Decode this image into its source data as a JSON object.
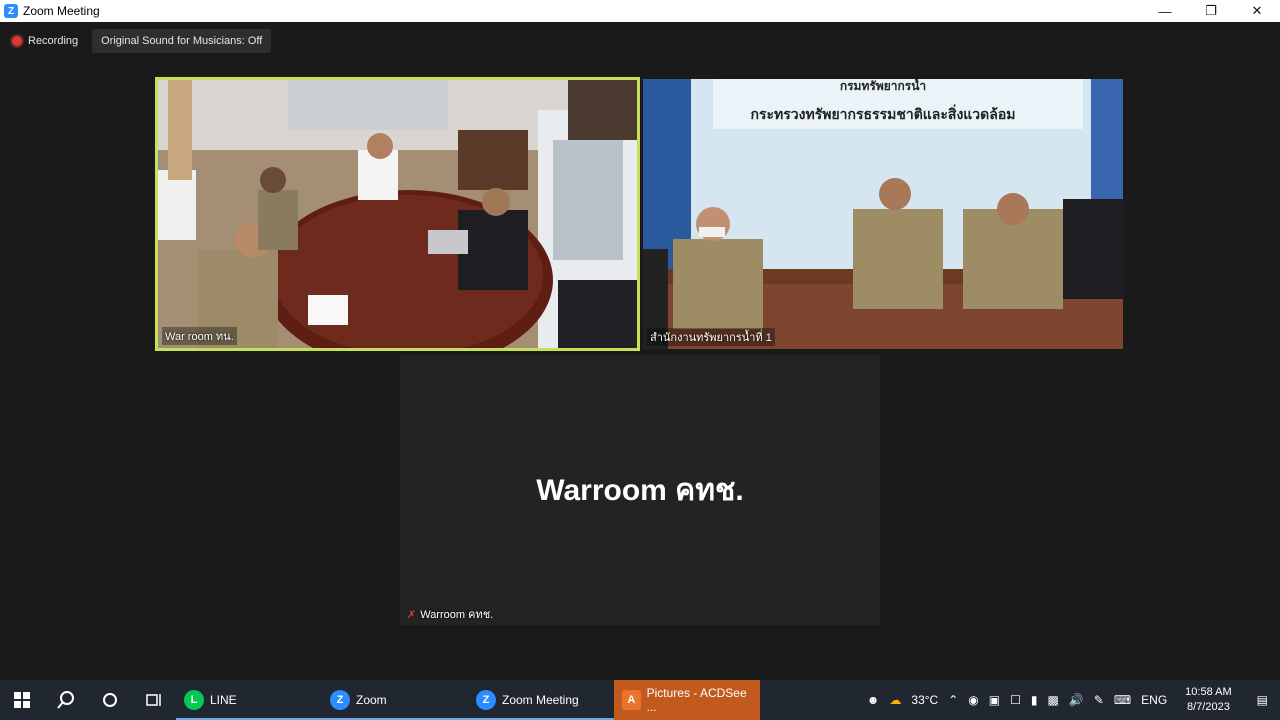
{
  "window": {
    "title": "Zoom Meeting"
  },
  "toolbar": {
    "recording_label": "Recording",
    "sound_label": "Original Sound for Musicians: Off"
  },
  "tiles": [
    {
      "name": "War room ทน."
    },
    {
      "name": "สำนักงานทรัพยากรน้ำที่ 1"
    },
    {
      "display_name": "Warroom คทช.",
      "name": "Warroom คทช."
    }
  ],
  "room_b_sign": {
    "line1": "กรมทรัพยากรน้ำ",
    "line2": "กระทรวงทรัพยากรธรรมชาติและสิ่งแวดล้อม"
  },
  "taskbar": {
    "apps": [
      {
        "label": "LINE",
        "color": "#06c755"
      },
      {
        "label": "Zoom",
        "color": "#2d8cff"
      },
      {
        "label": "Zoom Meeting",
        "color": "#2d8cff"
      },
      {
        "label": "Pictures - ACDSee ...",
        "color": "#e8742e"
      }
    ],
    "weather": "33°C",
    "lang": "ENG",
    "time": "10:58 AM",
    "date": "8/7/2023"
  },
  "colors": {
    "active_speaker": "#c7e05a",
    "background": "#1a1a1a"
  }
}
